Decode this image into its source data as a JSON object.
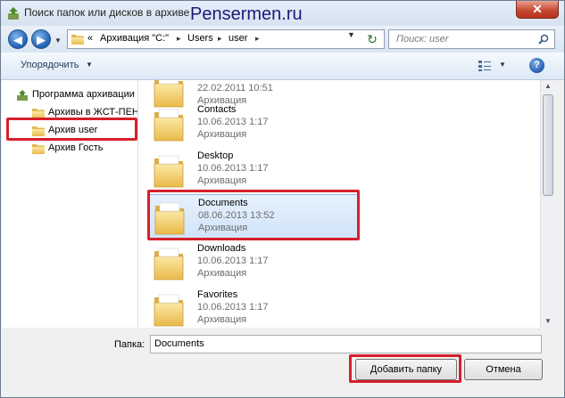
{
  "window": {
    "title": "Поиск папок или дисков в архиве",
    "watermark": "Pensermen.ru",
    "close_glyph": "✕"
  },
  "address": {
    "overflow": "«",
    "crumbs": [
      "Архивация \"C:\"",
      "Users",
      "user"
    ],
    "search_placeholder": "Поиск: user"
  },
  "toolbar": {
    "organize_label": "Упорядочить"
  },
  "nav": {
    "items": [
      {
        "label": "Программа архивации"
      },
      {
        "label": "Архивы в ЖСТ-ПЕН"
      },
      {
        "label": "Архив user"
      },
      {
        "label": "Архив Гость"
      }
    ]
  },
  "content": {
    "partial_top": {
      "date": "22.02.2011 10:51",
      "type": "Архивация"
    },
    "folders": [
      {
        "name": "Contacts",
        "date": "10.06.2013 1:17",
        "type": "Архивация"
      },
      {
        "name": "Desktop",
        "date": "10.06.2013 1:17",
        "type": "Архивация"
      },
      {
        "name": "Documents",
        "date": "08.06.2013 13:52",
        "type": "Архивация"
      },
      {
        "name": "Downloads",
        "date": "10.06.2013 1:17",
        "type": "Архивация"
      },
      {
        "name": "Favorites",
        "date": "10.06.2013 1:17",
        "type": "Архивация"
      }
    ]
  },
  "bottom": {
    "folder_label": "Папка:",
    "folder_value": "Documents",
    "add_button": "Добавить папку",
    "cancel_button": "Отмена"
  },
  "colors": {
    "highlight": "#d6202b",
    "folder": "#f3d26b"
  }
}
